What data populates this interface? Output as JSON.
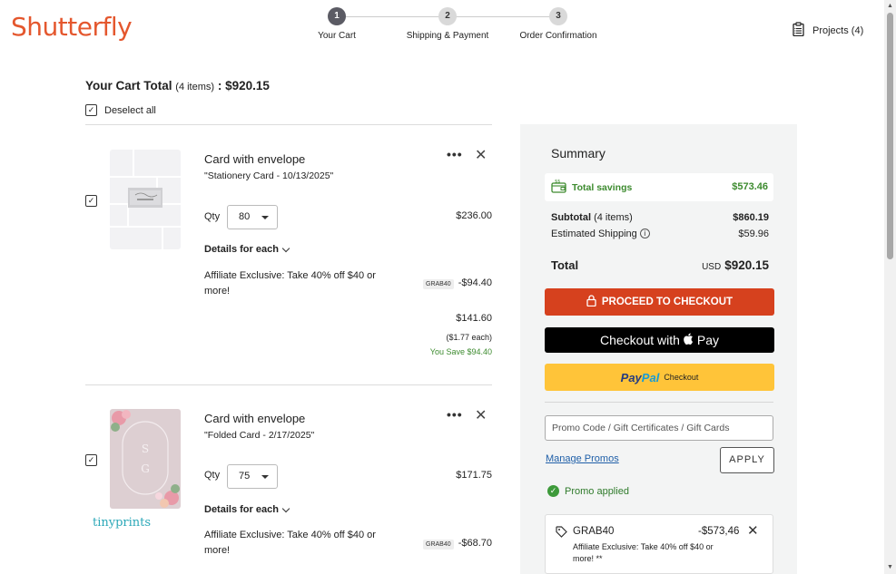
{
  "header": {
    "logo": "Shutterfly",
    "steps": [
      {
        "num": "1",
        "label": "Your Cart"
      },
      {
        "num": "2",
        "label": "Shipping & Payment"
      },
      {
        "num": "3",
        "label": "Order Confirmation"
      }
    ],
    "projects_label": "Projects (4)"
  },
  "cart": {
    "title_prefix": "Your Cart Total",
    "items_count": "(4 items)",
    "title_sep": " : ",
    "total": "$920.15",
    "deselect_label": "Deselect all",
    "items": [
      {
        "title": "Card with envelope",
        "subtitle": "\"Stationery Card - 10/13/2025\"",
        "qty_label": "Qty",
        "qty_value": "80",
        "price": "$236.00",
        "details_label": "Details for each",
        "promo_text": "Affiliate Exclusive: Take 40% off $40 or more!",
        "promo_code": "GRAB40",
        "promo_amount": "-$94.40",
        "final_price": "$141.60",
        "each_price": "($1.77 each)",
        "you_save": "You Save $94.40",
        "more_icon": "more-horizontal-icon",
        "close_icon": "close-icon"
      },
      {
        "title": "Card with envelope",
        "subtitle": "\"Folded Card - 2/17/2025\"",
        "qty_label": "Qty",
        "qty_value": "75",
        "price": "$171.75",
        "details_label": "Details for each",
        "promo_text": "Affiliate Exclusive: Take 40% off $40 or more!",
        "promo_code": "GRAB40",
        "promo_amount": "-$68.70",
        "brand": "tinyprints",
        "more_icon": "more-horizontal-icon",
        "close_icon": "close-icon"
      }
    ]
  },
  "summary": {
    "title": "Summary",
    "savings_label": "Total savings",
    "savings_value": "$573.46",
    "subtotal_label": "Subtotal",
    "subtotal_count": "(4 items)",
    "subtotal_value": "$860.19",
    "shipping_label": "Estimated Shipping",
    "shipping_value": "$59.96",
    "total_label": "Total",
    "currency": "USD",
    "total_value": "$920.15",
    "checkout_label": "PROCEED TO CHECKOUT",
    "apple_pay_prefix": "Checkout with",
    "apple_pay_suffix": "Pay",
    "paypal_pay": "Pay",
    "paypal_pal": "Pal",
    "paypal_suffix": "Checkout",
    "promo_placeholder": "Promo Code / Gift Certificates / Gift Cards",
    "manage_promos": "Manage Promos",
    "apply_label": "APPLY",
    "promo_applied": "Promo applied",
    "applied_code": "GRAB40",
    "applied_amount": "-$573,46",
    "applied_desc": "Affiliate Exclusive: Take 40% off $40 or more! **"
  },
  "colors": {
    "brand_orange": "#e4572e",
    "checkout_red": "#d6411e",
    "savings_green": "#3d8b2f",
    "paypal_yellow": "#ffc439",
    "link_blue": "#1f5fa8"
  }
}
